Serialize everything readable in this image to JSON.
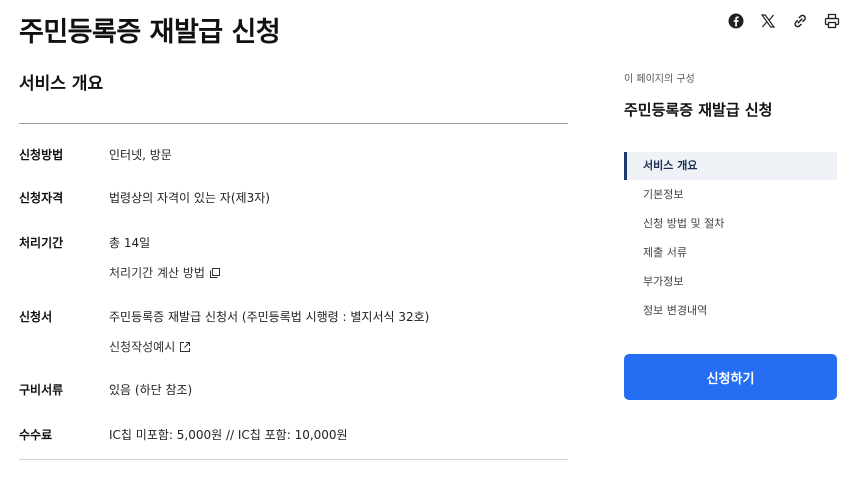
{
  "page": {
    "title": "주민등록증 재발급 신청"
  },
  "share": {
    "icons": [
      "facebook-icon",
      "x-icon",
      "link-icon",
      "print-icon"
    ]
  },
  "overview": {
    "title": "서비스 개요",
    "rows": [
      {
        "label": "신청방법",
        "value": "인터넷, 방문"
      },
      {
        "label": "신청자격",
        "value": "법령상의 자격이 있는 자(제3자)"
      },
      {
        "label": "처리기간",
        "value": "총 14일",
        "link": "처리기간 계산 방법"
      },
      {
        "label": "신청서",
        "value": "주민등록증 재발급 신청서 (주민등록법 시행령 : 별지서식 32호)",
        "link": "신청작성예시"
      },
      {
        "label": "구비서류",
        "value": "있음 (하단 참조)"
      },
      {
        "label": "수수료",
        "value": "IC칩 미포함: 5,000원 // IC칩 포함: 10,000원"
      }
    ]
  },
  "toc": {
    "caption": "이 페이지의 구성",
    "title": "주민등록증 재발급 신청",
    "items": [
      "서비스 개요",
      "기본정보",
      "신청 방법 및 절차",
      "제출 서류",
      "부가정보",
      "정보 변경내역"
    ],
    "active_index": 0
  },
  "actions": {
    "apply_label": "신청하기"
  },
  "colors": {
    "primary": "#256ef4",
    "toc_active_bar": "#1b3b6f",
    "toc_active_bg": "#eef1f5"
  }
}
